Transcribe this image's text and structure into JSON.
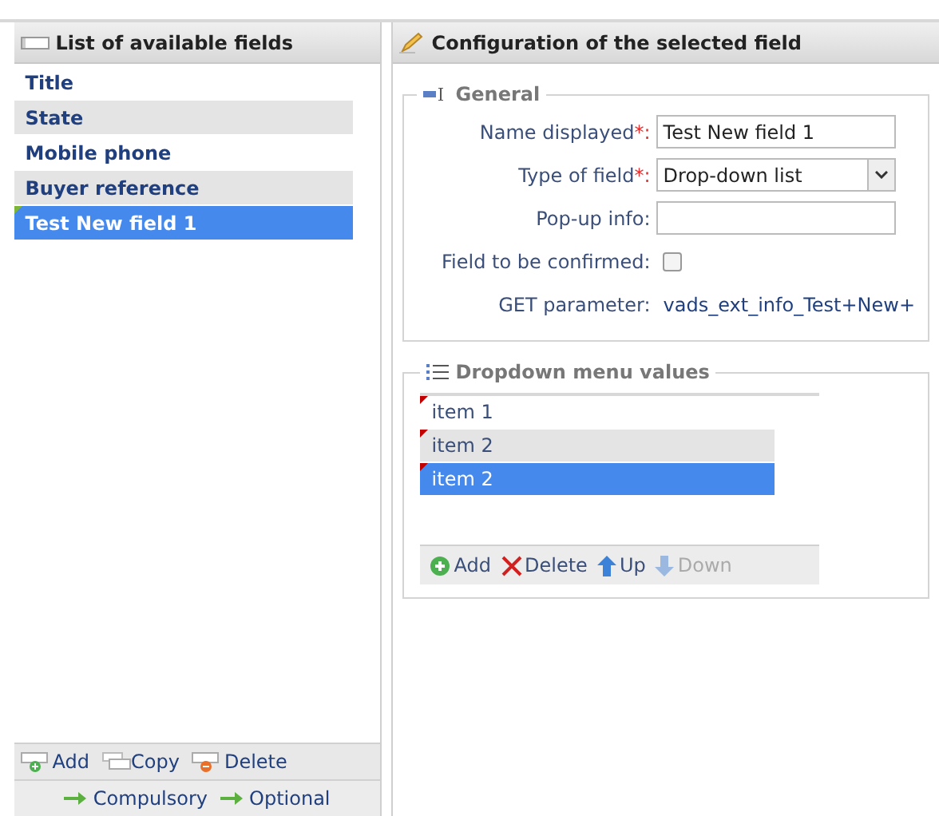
{
  "fields_panel": {
    "title": "List of available fields",
    "items": [
      {
        "label": "Title",
        "selected": false
      },
      {
        "label": "State",
        "selected": false
      },
      {
        "label": "Mobile phone",
        "selected": false
      },
      {
        "label": "Buyer reference",
        "selected": false
      },
      {
        "label": "Test New field 1",
        "selected": true
      }
    ],
    "toolbar": [
      {
        "kind": "add",
        "label": "Add"
      },
      {
        "kind": "copy",
        "label": "Copy"
      },
      {
        "kind": "delete",
        "label": "Delete"
      }
    ],
    "legend": [
      "Compulsory",
      "Optional"
    ]
  },
  "config_panel": {
    "title": "Configuration of the selected field",
    "general": {
      "legend": "General",
      "rows": [
        {
          "kind": "text",
          "label": "Name displayed",
          "required_mark": "*:",
          "value": "Test New field 1"
        },
        {
          "kind": "select",
          "label": "Type of field",
          "required_mark": "*:",
          "value": "Drop-down list"
        },
        {
          "kind": "text",
          "label": "Pop-up info:",
          "value": ""
        },
        {
          "kind": "checkbox",
          "label": "Field to be confirmed:",
          "checked": false
        },
        {
          "kind": "static",
          "label": "GET parameter:",
          "value": "vads_ext_info_Test+New+"
        }
      ]
    },
    "dropdown_values": {
      "legend": "Dropdown menu values",
      "items": [
        {
          "label": "item 1",
          "selected": false
        },
        {
          "label": "item 2",
          "selected": false
        },
        {
          "label": "item 2",
          "selected": true
        }
      ],
      "toolbar": [
        {
          "kind": "add",
          "label": "Add",
          "disabled": false
        },
        {
          "kind": "delete",
          "label": "Delete",
          "disabled": false
        },
        {
          "kind": "up",
          "label": "Up",
          "disabled": false
        },
        {
          "kind": "down",
          "label": "Down",
          "disabled": true
        }
      ]
    }
  }
}
